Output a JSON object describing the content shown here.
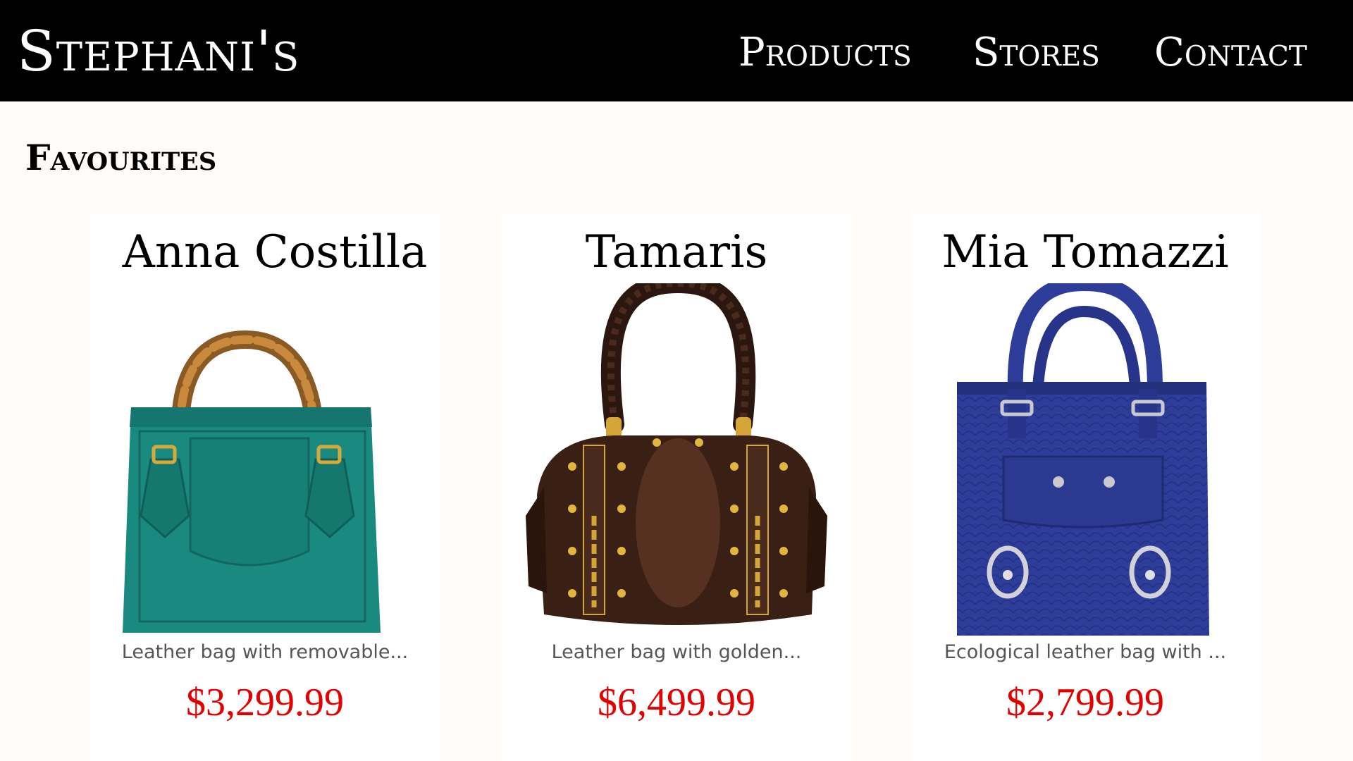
{
  "header": {
    "logo": "Stephani's",
    "nav": [
      "Products",
      "Stores",
      "Contact"
    ]
  },
  "section": {
    "title": "Favourites"
  },
  "products": [
    {
      "name": "Anna Costilla",
      "description": "Leather bag with removable...",
      "price": "$3,299.99",
      "color": "#1a8a80"
    },
    {
      "name": "Tamaris",
      "description": "Leather bag with golden...",
      "price": "$6,499.99",
      "color": "#3a1f14"
    },
    {
      "name": "Mia Tomazzi",
      "description": "Ecological leather bag with ...",
      "price": "$2,799.99",
      "color": "#2e3d9a"
    }
  ],
  "colors": {
    "header_bg": "#000000",
    "page_bg": "#fffcf9",
    "price": "#e20000"
  }
}
